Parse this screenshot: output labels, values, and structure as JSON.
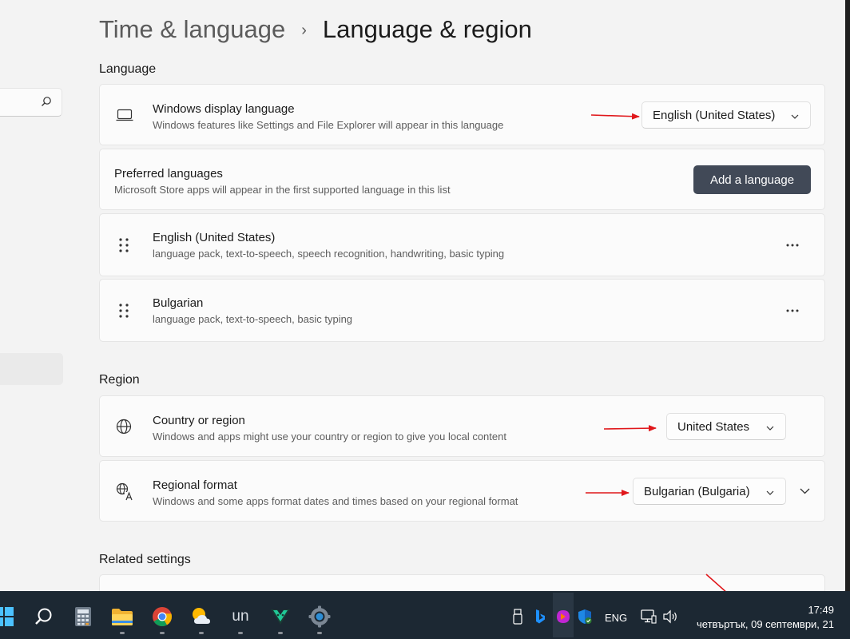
{
  "header": {
    "parent": "Time & language",
    "separator": "›",
    "current": "Language & region"
  },
  "language_section": {
    "title": "Language",
    "display_language": {
      "title": "Windows display language",
      "description": "Windows features like Settings and File Explorer will appear in this language",
      "value": "English (United States)"
    },
    "preferred": {
      "title": "Preferred languages",
      "description": "Microsoft Store apps will appear in the first supported language in this list",
      "button": "Add a language"
    },
    "languages": [
      {
        "name": "English (United States)",
        "features": "language pack, text-to-speech, speech recognition, handwriting, basic typing"
      },
      {
        "name": "Bulgarian",
        "features": "language pack, text-to-speech, basic typing"
      }
    ]
  },
  "region_section": {
    "title": "Region",
    "country": {
      "title": "Country or region",
      "description": "Windows and apps might use your country or region to give you local content",
      "value": "United States"
    },
    "format": {
      "title": "Regional format",
      "description": "Windows and some apps format dates and times based on your regional format",
      "value": "Bulgarian (Bulgaria)"
    }
  },
  "related": {
    "title": "Related settings"
  },
  "taskbar": {
    "apps": [
      "start-icon",
      "search-icon",
      "calculator-icon",
      "file-explorer-icon",
      "chrome-icon",
      "weather-icon",
      "un-app-icon",
      "terminal-app-icon",
      "settings-app-icon"
    ],
    "un_label": "un",
    "input_language": "ENG",
    "time": "17:49",
    "date": "четвъртък, 09 септември, 21"
  },
  "colors": {
    "accent_button": "#414957",
    "annotation_arrow": "#e0171b",
    "taskbar": "#1c2833"
  }
}
